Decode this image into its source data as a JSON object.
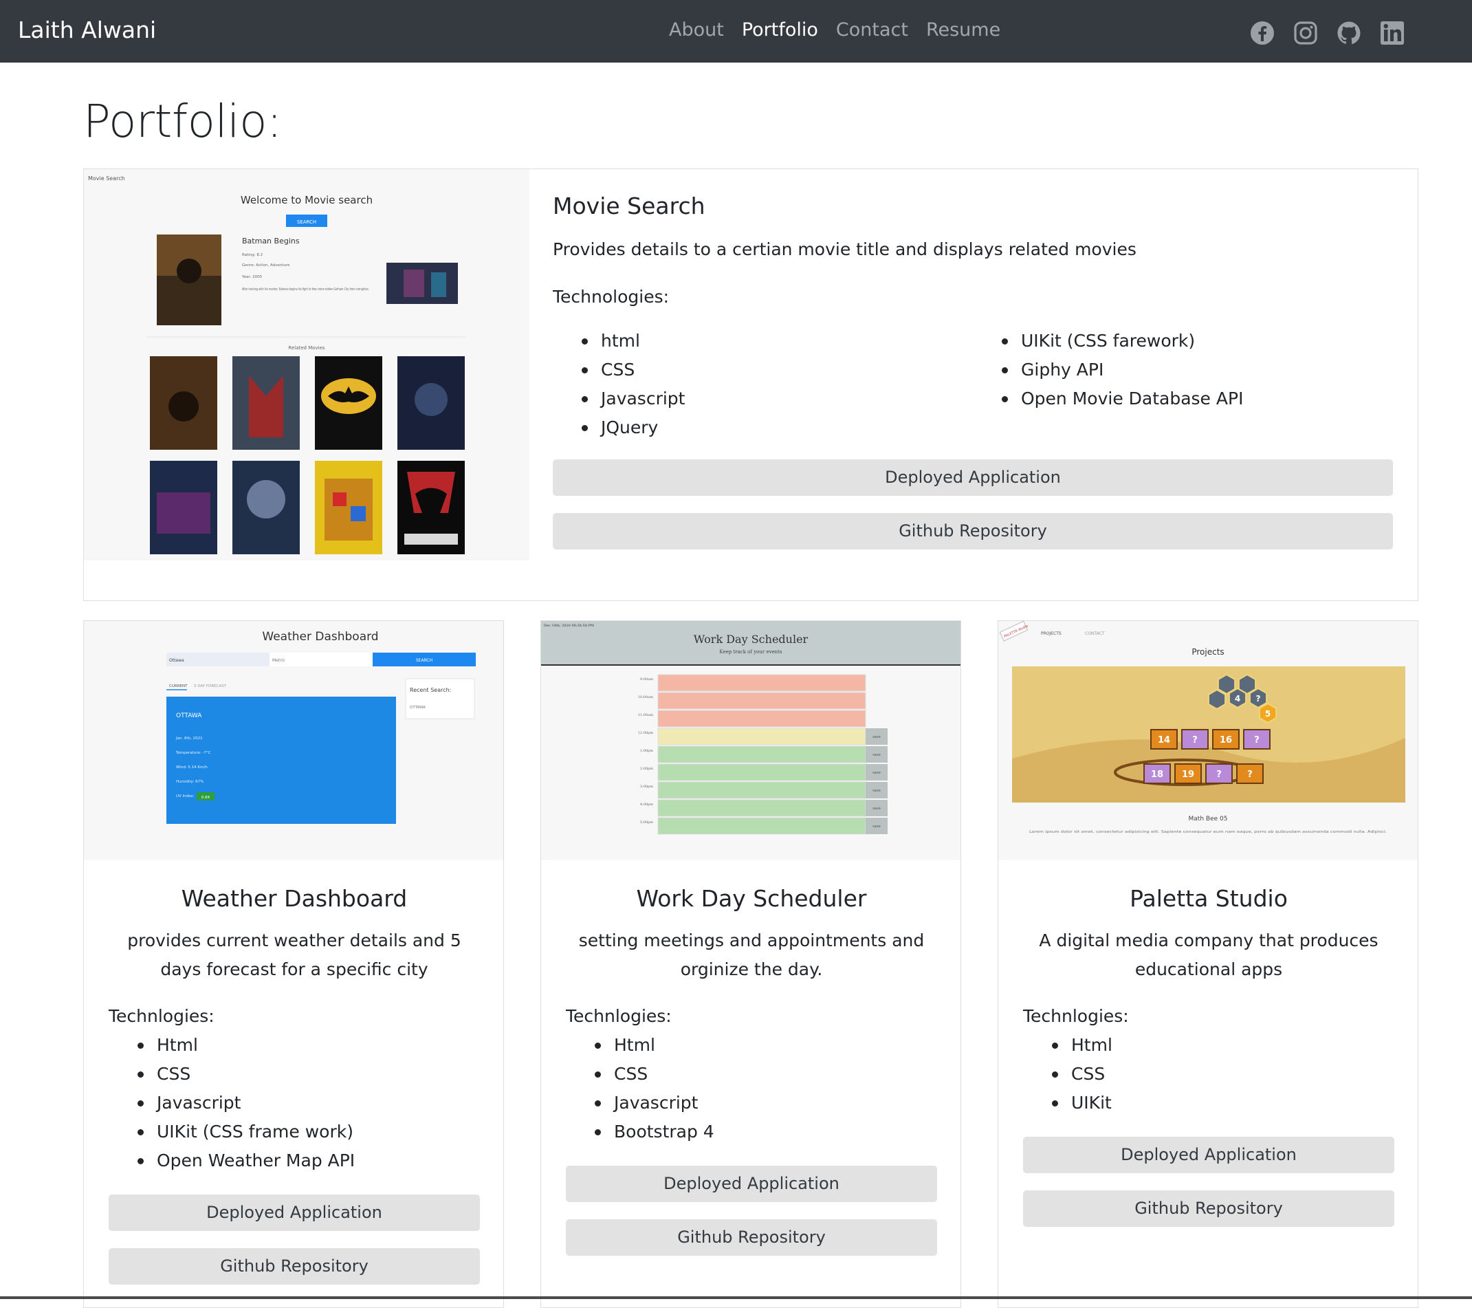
{
  "navbar": {
    "brand": "Laith Alwani",
    "links": [
      "About",
      "Portfolio",
      "Contact",
      "Resume"
    ],
    "active": "Portfolio",
    "social": [
      "facebook-icon",
      "instagram-icon",
      "github-icon",
      "linkedin-icon"
    ]
  },
  "page": {
    "title": "Portfolio:"
  },
  "featured": {
    "title": "Movie Search",
    "description": "Provides details to a certian movie title and displays related movies",
    "tech_label": "Technologies:",
    "tech_col1": [
      "html",
      "CSS",
      "Javascript",
      "JQuery"
    ],
    "tech_col2": [
      "UIKit (CSS farework)",
      "Giphy API",
      "Open Movie Database API"
    ],
    "deploy_label": "Deployed Application",
    "repo_label": "Github Repository",
    "screenshot": {
      "corner": "Movie Search",
      "heading": "Welcome to Movie search",
      "button": "SEARCH",
      "movie": "Batman Begins",
      "rating": "Rating: 8.2",
      "genre": "Genre: Action, Adventure",
      "year": "Year: 2005",
      "plot": "After training with his mentor, Batman begins his fight to free crime-ridden Gotham City from corruption.",
      "related": "Related Movies"
    }
  },
  "cards": [
    {
      "title": "Weather Dashboard",
      "description": "provides current weather details and 5 days forecast for a specific city",
      "tech_label": "Technlogies:",
      "tech": [
        "Html",
        "CSS",
        "Javascript",
        "UIKit (CSS frame work)",
        "Open Weather Map API"
      ],
      "deploy_label": "Deployed Application",
      "repo_label": "Github Repository",
      "screenshot": {
        "heading": "Weather Dashboard",
        "input": "Ottawa",
        "unit": "Metric",
        "button": "SEARCH",
        "tab1": "CURRENT",
        "tab2": "5 DAY FORECAST",
        "city": "OTTAWA",
        "date": "Jan. 8th, 2021",
        "temp": "Temperature: -7°C",
        "wind": "Wind: 5.14 Km/h",
        "humidity": "Humidity: 67%",
        "uv_label": "UV Index:",
        "uv": "0.84",
        "recent_title": "Recent Search:",
        "recent_item": "OTTAWA"
      }
    },
    {
      "title": "Work Day Scheduler",
      "description": "setting meetings and appointments and orginize the day.",
      "tech_label": "Technlogies:",
      "tech": [
        "Html",
        "CSS",
        "Javascript",
        "Bootstrap 4"
      ],
      "deploy_label": "Deployed Application",
      "repo_label": "Github Repository",
      "screenshot": {
        "date": "Dec 14th, 2020 08:38:58 PM",
        "heading": "Work Day Scheduler",
        "sub": "Keep track of your events",
        "hours": [
          "9:00am",
          "10:00am",
          "11:00am",
          "12:00pm",
          "1:00pm",
          "2:00pm",
          "3:00pm",
          "4:00pm",
          "5:00pm"
        ],
        "save": "save"
      }
    },
    {
      "title": "Paletta Studio",
      "description": "A digital media company that produces educational apps",
      "tech_label": "Technlogies:",
      "tech": [
        "Html",
        "CSS",
        "UIKit"
      ],
      "deploy_label": "Deployed Application",
      "repo_label": "Github Repository",
      "screenshot": {
        "logo": "PALETTA studio",
        "nav1": "PROJECTS",
        "nav2": "CONTACT",
        "heading": "Projects",
        "caption": "Math Bee 05",
        "lorem": "Lorem ipsum dolor sit amet, consectetur adipisicing elit. Sapiente consequatur eum nam eaque, porro ab quibusdam assumenda commodi nulla. Adipisci.",
        "numbers": [
          "14",
          "?",
          "16",
          "?",
          "18",
          "19",
          "?",
          "?"
        ],
        "hex": [
          "4",
          "?",
          "5"
        ]
      }
    }
  ],
  "colors": {
    "navbar": "#343a40",
    "button": "#e2e2e2",
    "weather_blue": "#1e88e5",
    "scheduler_past": "#f4b7a5",
    "scheduler_present": "#f0e9b4",
    "scheduler_future": "#b5ddb0"
  }
}
